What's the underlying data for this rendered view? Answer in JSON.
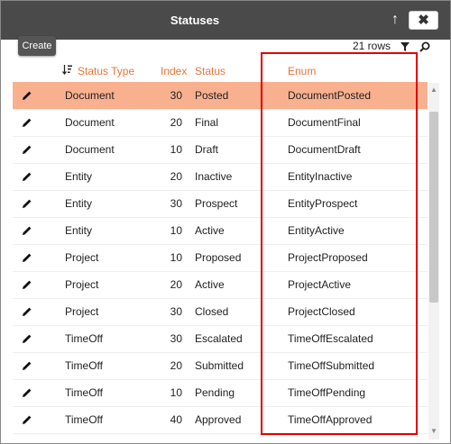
{
  "window": {
    "title": "Statuses",
    "move_up_icon": "arrow-up-icon",
    "close_icon": "close-icon",
    "close_label": "✖"
  },
  "toolbar": {
    "create_label": "Create",
    "rows_count": "21 rows",
    "filter_icon": "filter-icon",
    "search_icon": "search-icon"
  },
  "table": {
    "columns": {
      "status_type": "Status Type",
      "index": "Index",
      "status": "Status",
      "enum": "Enum"
    },
    "sort_icon": "sort-descending-icon",
    "selected_row": 0,
    "rows": [
      {
        "type": "Document",
        "index": "30",
        "status": "Posted",
        "enum": "DocumentPosted"
      },
      {
        "type": "Document",
        "index": "20",
        "status": "Final",
        "enum": "DocumentFinal"
      },
      {
        "type": "Document",
        "index": "10",
        "status": "Draft",
        "enum": "DocumentDraft"
      },
      {
        "type": "Entity",
        "index": "20",
        "status": "Inactive",
        "enum": "EntityInactive"
      },
      {
        "type": "Entity",
        "index": "30",
        "status": "Prospect",
        "enum": "EntityProspect"
      },
      {
        "type": "Entity",
        "index": "10",
        "status": "Active",
        "enum": "EntityActive"
      },
      {
        "type": "Project",
        "index": "10",
        "status": "Proposed",
        "enum": "ProjectProposed"
      },
      {
        "type": "Project",
        "index": "20",
        "status": "Active",
        "enum": "ProjectActive"
      },
      {
        "type": "Project",
        "index": "30",
        "status": "Closed",
        "enum": "ProjectClosed"
      },
      {
        "type": "TimeOff",
        "index": "30",
        "status": "Escalated",
        "enum": "TimeOffEscalated"
      },
      {
        "type": "TimeOff",
        "index": "20",
        "status": "Submitted",
        "enum": "TimeOffSubmitted"
      },
      {
        "type": "TimeOff",
        "index": "10",
        "status": "Pending",
        "enum": "TimeOffPending"
      },
      {
        "type": "TimeOff",
        "index": "40",
        "status": "Approved",
        "enum": "TimeOffApproved"
      }
    ]
  },
  "colors": {
    "titlebar": "#4a4a4a",
    "header_text": "#e8743b",
    "selected_row": "#f8b08f",
    "highlight_border": "#e00000"
  }
}
